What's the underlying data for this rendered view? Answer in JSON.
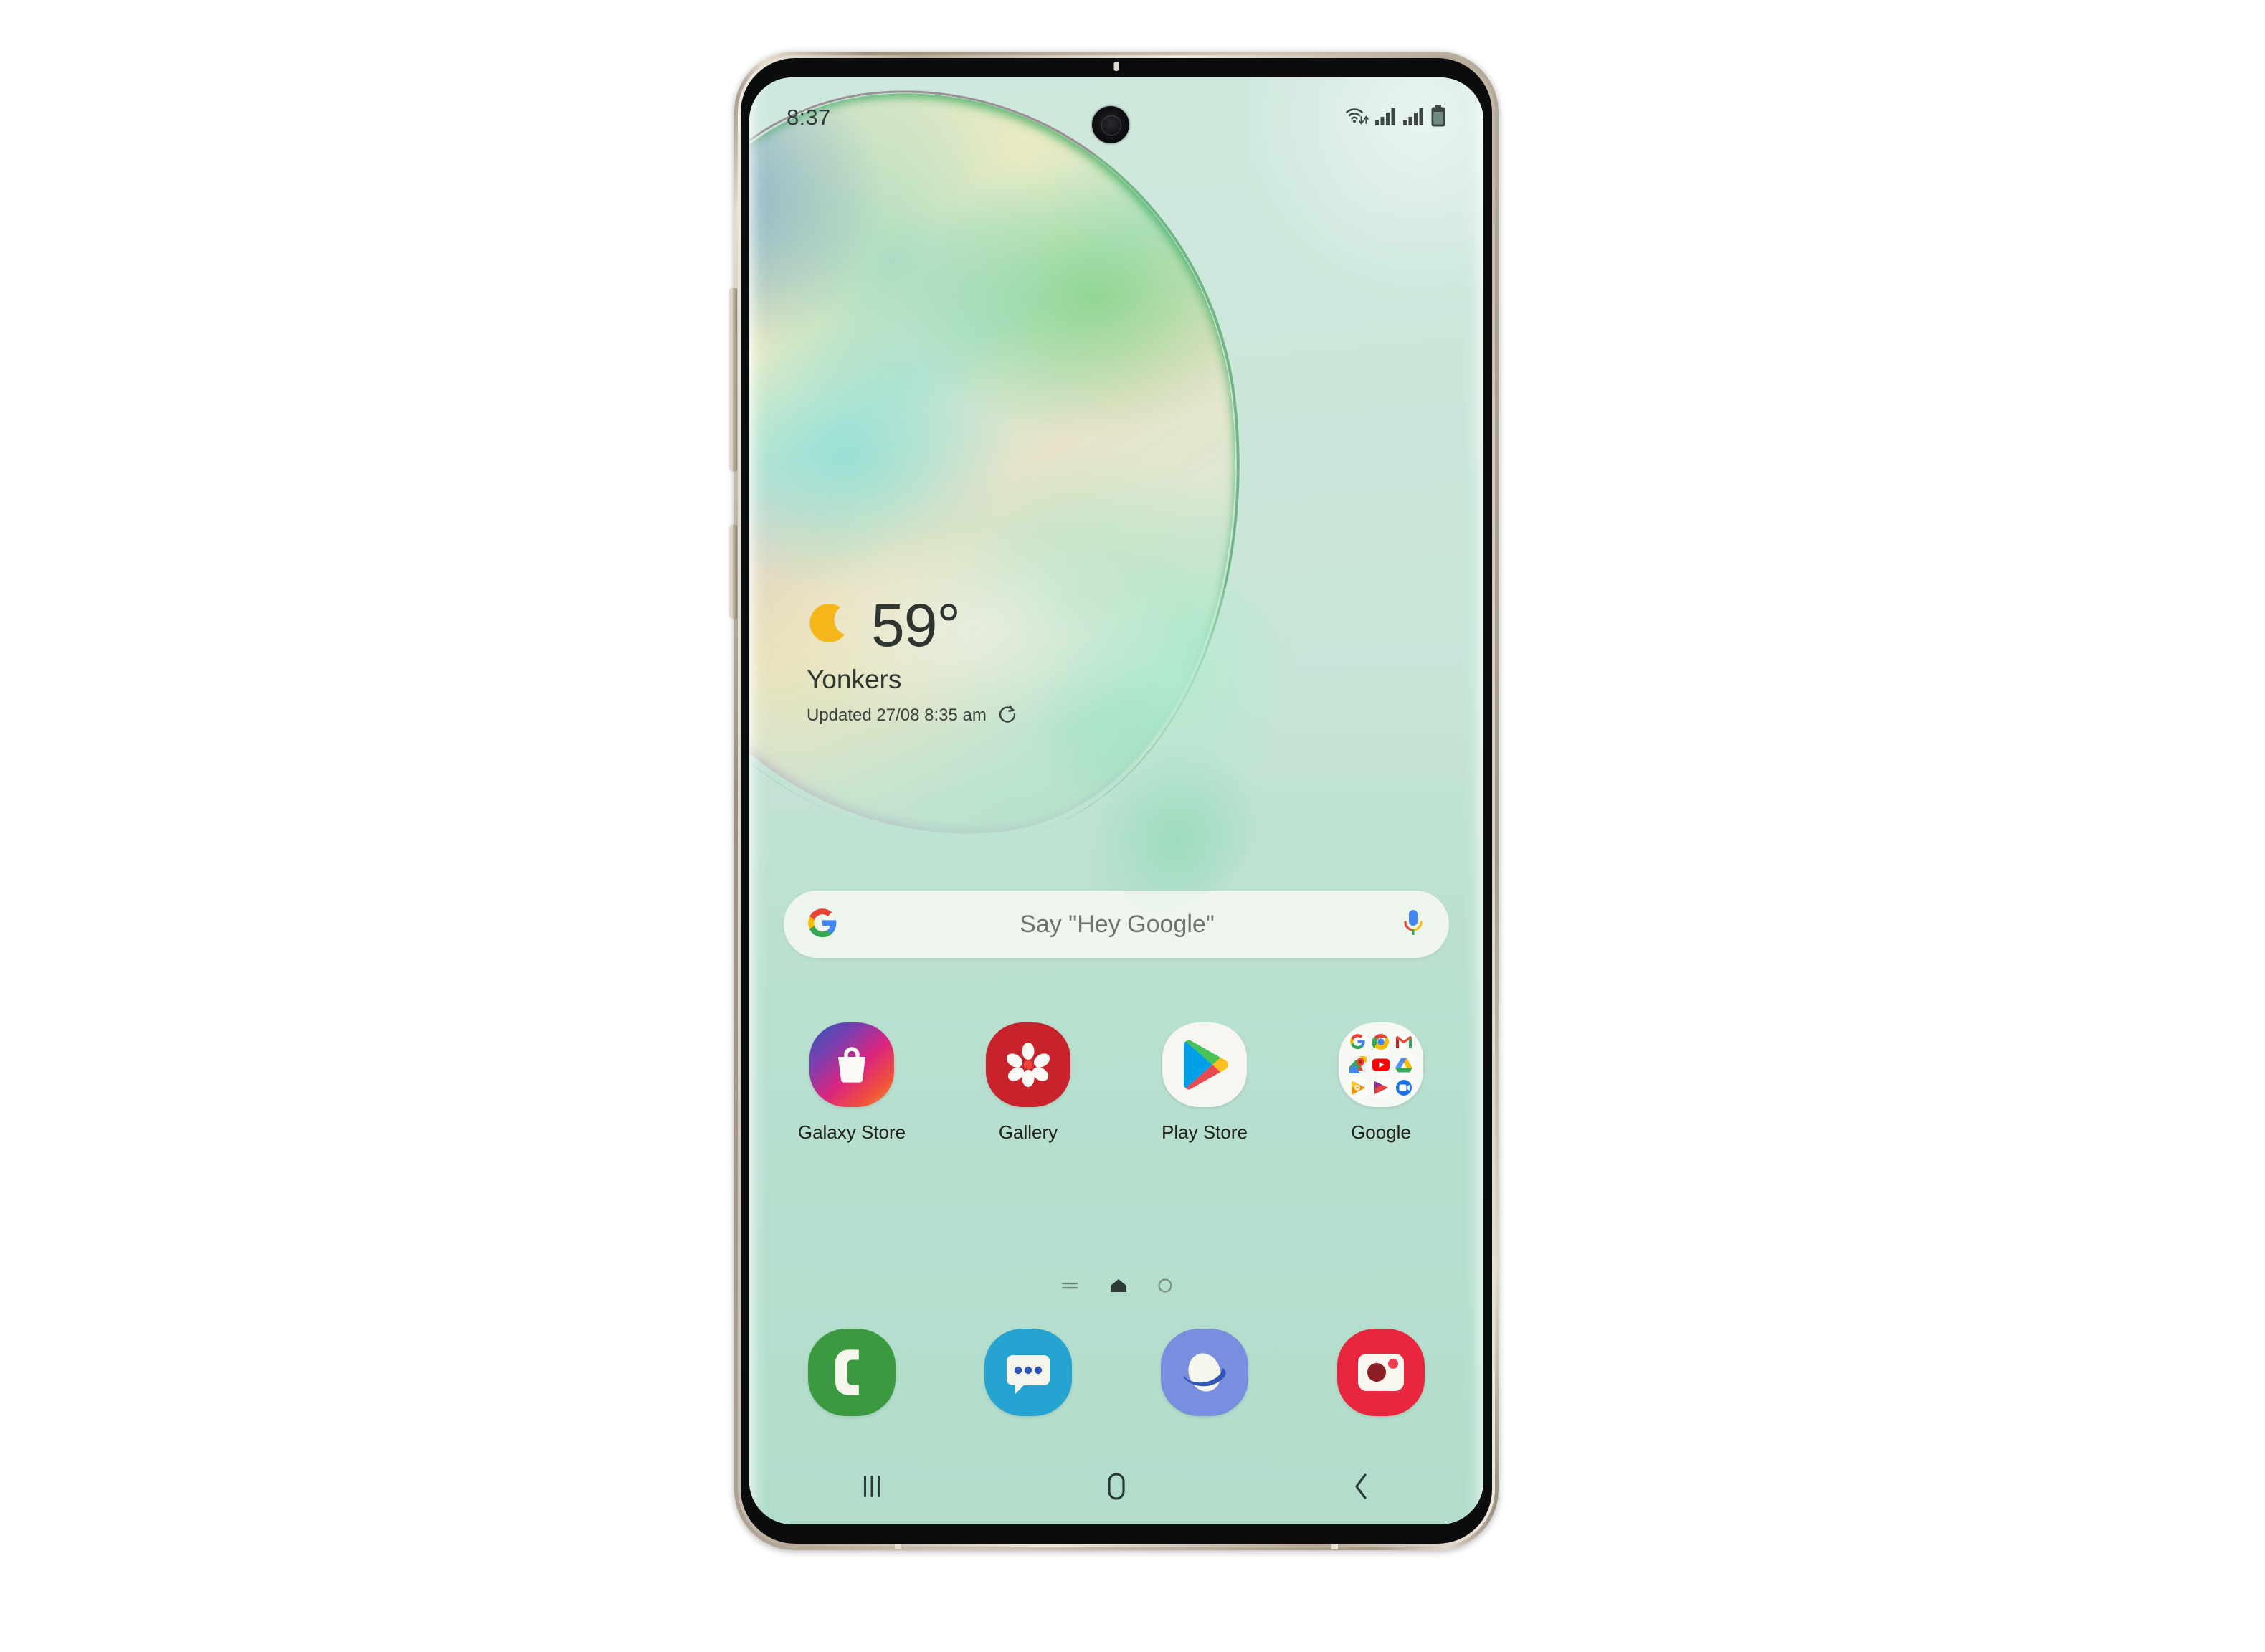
{
  "device": {
    "model_shape": "samsung-galaxy-note10-plus",
    "frame_color": "#c9bdac",
    "screen_bg": "#bfe2d3"
  },
  "status_bar": {
    "time": "8:37",
    "icons": [
      {
        "name": "wifi-icon",
        "label": "Wi-Fi with data transfer arrows"
      },
      {
        "name": "signal-sim1-icon",
        "label": "Cellular signal SIM 1",
        "bars": 4
      },
      {
        "name": "signal-sim2-icon",
        "label": "Cellular signal SIM 2",
        "bars": 4
      },
      {
        "name": "battery-icon",
        "label": "Battery",
        "level_pct": 85
      }
    ]
  },
  "weather_widget": {
    "condition_icon": "crescent-moon-icon",
    "temperature": "59",
    "degree_symbol": "°",
    "city": "Yonkers",
    "updated_text": "Updated 27/08 8:35 am",
    "refresh_icon": "refresh-icon"
  },
  "search_bar": {
    "google_logo": "google-g-icon",
    "placeholder": "Say \"Hey Google\"",
    "mic_icon": "microphone-icon"
  },
  "apps": [
    {
      "label": "Galaxy Store",
      "icon": "galaxy-store-icon",
      "color": "#d9257f"
    },
    {
      "label": "Gallery",
      "icon": "gallery-icon",
      "color": "#c8232d"
    },
    {
      "label": "Play Store",
      "icon": "play-store-icon",
      "color": "#f7f6f1"
    },
    {
      "label": "Google",
      "icon": "google-folder-icon",
      "color": "#fafaf5"
    }
  ],
  "google_folder_apps": [
    "google-icon",
    "chrome-icon",
    "gmail-icon",
    "maps-icon",
    "youtube-icon",
    "drive-icon",
    "play-music-icon",
    "play-movies-icon",
    "duo-icon"
  ],
  "page_indicator": {
    "pages": [
      {
        "name": "page-dot-feed",
        "icon": "lines-icon",
        "active": false
      },
      {
        "name": "page-dot-home",
        "icon": "home-icon",
        "active": true
      },
      {
        "name": "page-dot-next",
        "icon": "circle-icon",
        "active": false
      }
    ]
  },
  "dock": [
    {
      "label": "Phone",
      "icon": "phone-icon",
      "color": "#3b9a3f"
    },
    {
      "label": "Messages",
      "icon": "messages-icon",
      "color": "#25a3d1"
    },
    {
      "label": "Internet",
      "icon": "internet-browser-icon",
      "color": "#7a8ee0"
    },
    {
      "label": "Camera",
      "icon": "camera-icon",
      "color": "#e8273f"
    }
  ],
  "nav_bar": [
    {
      "name": "recents-button",
      "icon": "recents-icon",
      "label": "Recent apps"
    },
    {
      "name": "home-button",
      "icon": "home-nav-icon",
      "label": "Home"
    },
    {
      "name": "back-button",
      "icon": "back-chevron-icon",
      "label": "Back"
    }
  ],
  "hardware": [
    {
      "name": "volume-rocker",
      "label": "Volume"
    },
    {
      "name": "power-button",
      "label": "Side key"
    },
    {
      "name": "front-camera",
      "label": "Punch-hole front camera"
    },
    {
      "name": "earpiece-speaker",
      "label": "Earpiece"
    }
  ]
}
